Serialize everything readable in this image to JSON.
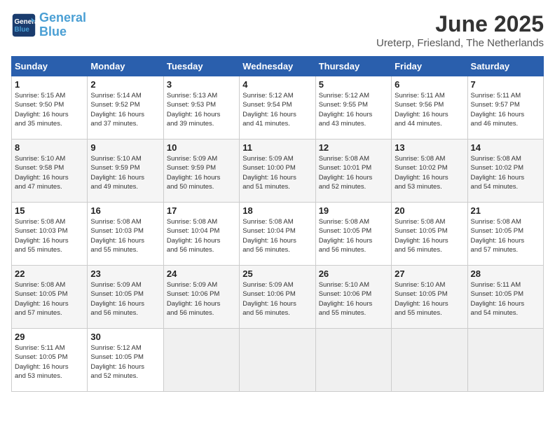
{
  "header": {
    "logo_line1": "General",
    "logo_line2": "Blue",
    "title": "June 2025",
    "subtitle": "Ureterp, Friesland, The Netherlands"
  },
  "weekdays": [
    "Sunday",
    "Monday",
    "Tuesday",
    "Wednesday",
    "Thursday",
    "Friday",
    "Saturday"
  ],
  "weeks": [
    [
      {
        "day": "1",
        "info": "Sunrise: 5:15 AM\nSunset: 9:50 PM\nDaylight: 16 hours\nand 35 minutes."
      },
      {
        "day": "2",
        "info": "Sunrise: 5:14 AM\nSunset: 9:52 PM\nDaylight: 16 hours\nand 37 minutes."
      },
      {
        "day": "3",
        "info": "Sunrise: 5:13 AM\nSunset: 9:53 PM\nDaylight: 16 hours\nand 39 minutes."
      },
      {
        "day": "4",
        "info": "Sunrise: 5:12 AM\nSunset: 9:54 PM\nDaylight: 16 hours\nand 41 minutes."
      },
      {
        "day": "5",
        "info": "Sunrise: 5:12 AM\nSunset: 9:55 PM\nDaylight: 16 hours\nand 43 minutes."
      },
      {
        "day": "6",
        "info": "Sunrise: 5:11 AM\nSunset: 9:56 PM\nDaylight: 16 hours\nand 44 minutes."
      },
      {
        "day": "7",
        "info": "Sunrise: 5:11 AM\nSunset: 9:57 PM\nDaylight: 16 hours\nand 46 minutes."
      }
    ],
    [
      {
        "day": "8",
        "info": "Sunrise: 5:10 AM\nSunset: 9:58 PM\nDaylight: 16 hours\nand 47 minutes."
      },
      {
        "day": "9",
        "info": "Sunrise: 5:10 AM\nSunset: 9:59 PM\nDaylight: 16 hours\nand 49 minutes."
      },
      {
        "day": "10",
        "info": "Sunrise: 5:09 AM\nSunset: 9:59 PM\nDaylight: 16 hours\nand 50 minutes."
      },
      {
        "day": "11",
        "info": "Sunrise: 5:09 AM\nSunset: 10:00 PM\nDaylight: 16 hours\nand 51 minutes."
      },
      {
        "day": "12",
        "info": "Sunrise: 5:08 AM\nSunset: 10:01 PM\nDaylight: 16 hours\nand 52 minutes."
      },
      {
        "day": "13",
        "info": "Sunrise: 5:08 AM\nSunset: 10:02 PM\nDaylight: 16 hours\nand 53 minutes."
      },
      {
        "day": "14",
        "info": "Sunrise: 5:08 AM\nSunset: 10:02 PM\nDaylight: 16 hours\nand 54 minutes."
      }
    ],
    [
      {
        "day": "15",
        "info": "Sunrise: 5:08 AM\nSunset: 10:03 PM\nDaylight: 16 hours\nand 55 minutes."
      },
      {
        "day": "16",
        "info": "Sunrise: 5:08 AM\nSunset: 10:03 PM\nDaylight: 16 hours\nand 55 minutes."
      },
      {
        "day": "17",
        "info": "Sunrise: 5:08 AM\nSunset: 10:04 PM\nDaylight: 16 hours\nand 56 minutes."
      },
      {
        "day": "18",
        "info": "Sunrise: 5:08 AM\nSunset: 10:04 PM\nDaylight: 16 hours\nand 56 minutes."
      },
      {
        "day": "19",
        "info": "Sunrise: 5:08 AM\nSunset: 10:05 PM\nDaylight: 16 hours\nand 56 minutes."
      },
      {
        "day": "20",
        "info": "Sunrise: 5:08 AM\nSunset: 10:05 PM\nDaylight: 16 hours\nand 56 minutes."
      },
      {
        "day": "21",
        "info": "Sunrise: 5:08 AM\nSunset: 10:05 PM\nDaylight: 16 hours\nand 57 minutes."
      }
    ],
    [
      {
        "day": "22",
        "info": "Sunrise: 5:08 AM\nSunset: 10:05 PM\nDaylight: 16 hours\nand 57 minutes."
      },
      {
        "day": "23",
        "info": "Sunrise: 5:09 AM\nSunset: 10:05 PM\nDaylight: 16 hours\nand 56 minutes."
      },
      {
        "day": "24",
        "info": "Sunrise: 5:09 AM\nSunset: 10:06 PM\nDaylight: 16 hours\nand 56 minutes."
      },
      {
        "day": "25",
        "info": "Sunrise: 5:09 AM\nSunset: 10:06 PM\nDaylight: 16 hours\nand 56 minutes."
      },
      {
        "day": "26",
        "info": "Sunrise: 5:10 AM\nSunset: 10:06 PM\nDaylight: 16 hours\nand 55 minutes."
      },
      {
        "day": "27",
        "info": "Sunrise: 5:10 AM\nSunset: 10:05 PM\nDaylight: 16 hours\nand 55 minutes."
      },
      {
        "day": "28",
        "info": "Sunrise: 5:11 AM\nSunset: 10:05 PM\nDaylight: 16 hours\nand 54 minutes."
      }
    ],
    [
      {
        "day": "29",
        "info": "Sunrise: 5:11 AM\nSunset: 10:05 PM\nDaylight: 16 hours\nand 53 minutes."
      },
      {
        "day": "30",
        "info": "Sunrise: 5:12 AM\nSunset: 10:05 PM\nDaylight: 16 hours\nand 52 minutes."
      },
      {
        "day": "",
        "info": ""
      },
      {
        "day": "",
        "info": ""
      },
      {
        "day": "",
        "info": ""
      },
      {
        "day": "",
        "info": ""
      },
      {
        "day": "",
        "info": ""
      }
    ]
  ]
}
